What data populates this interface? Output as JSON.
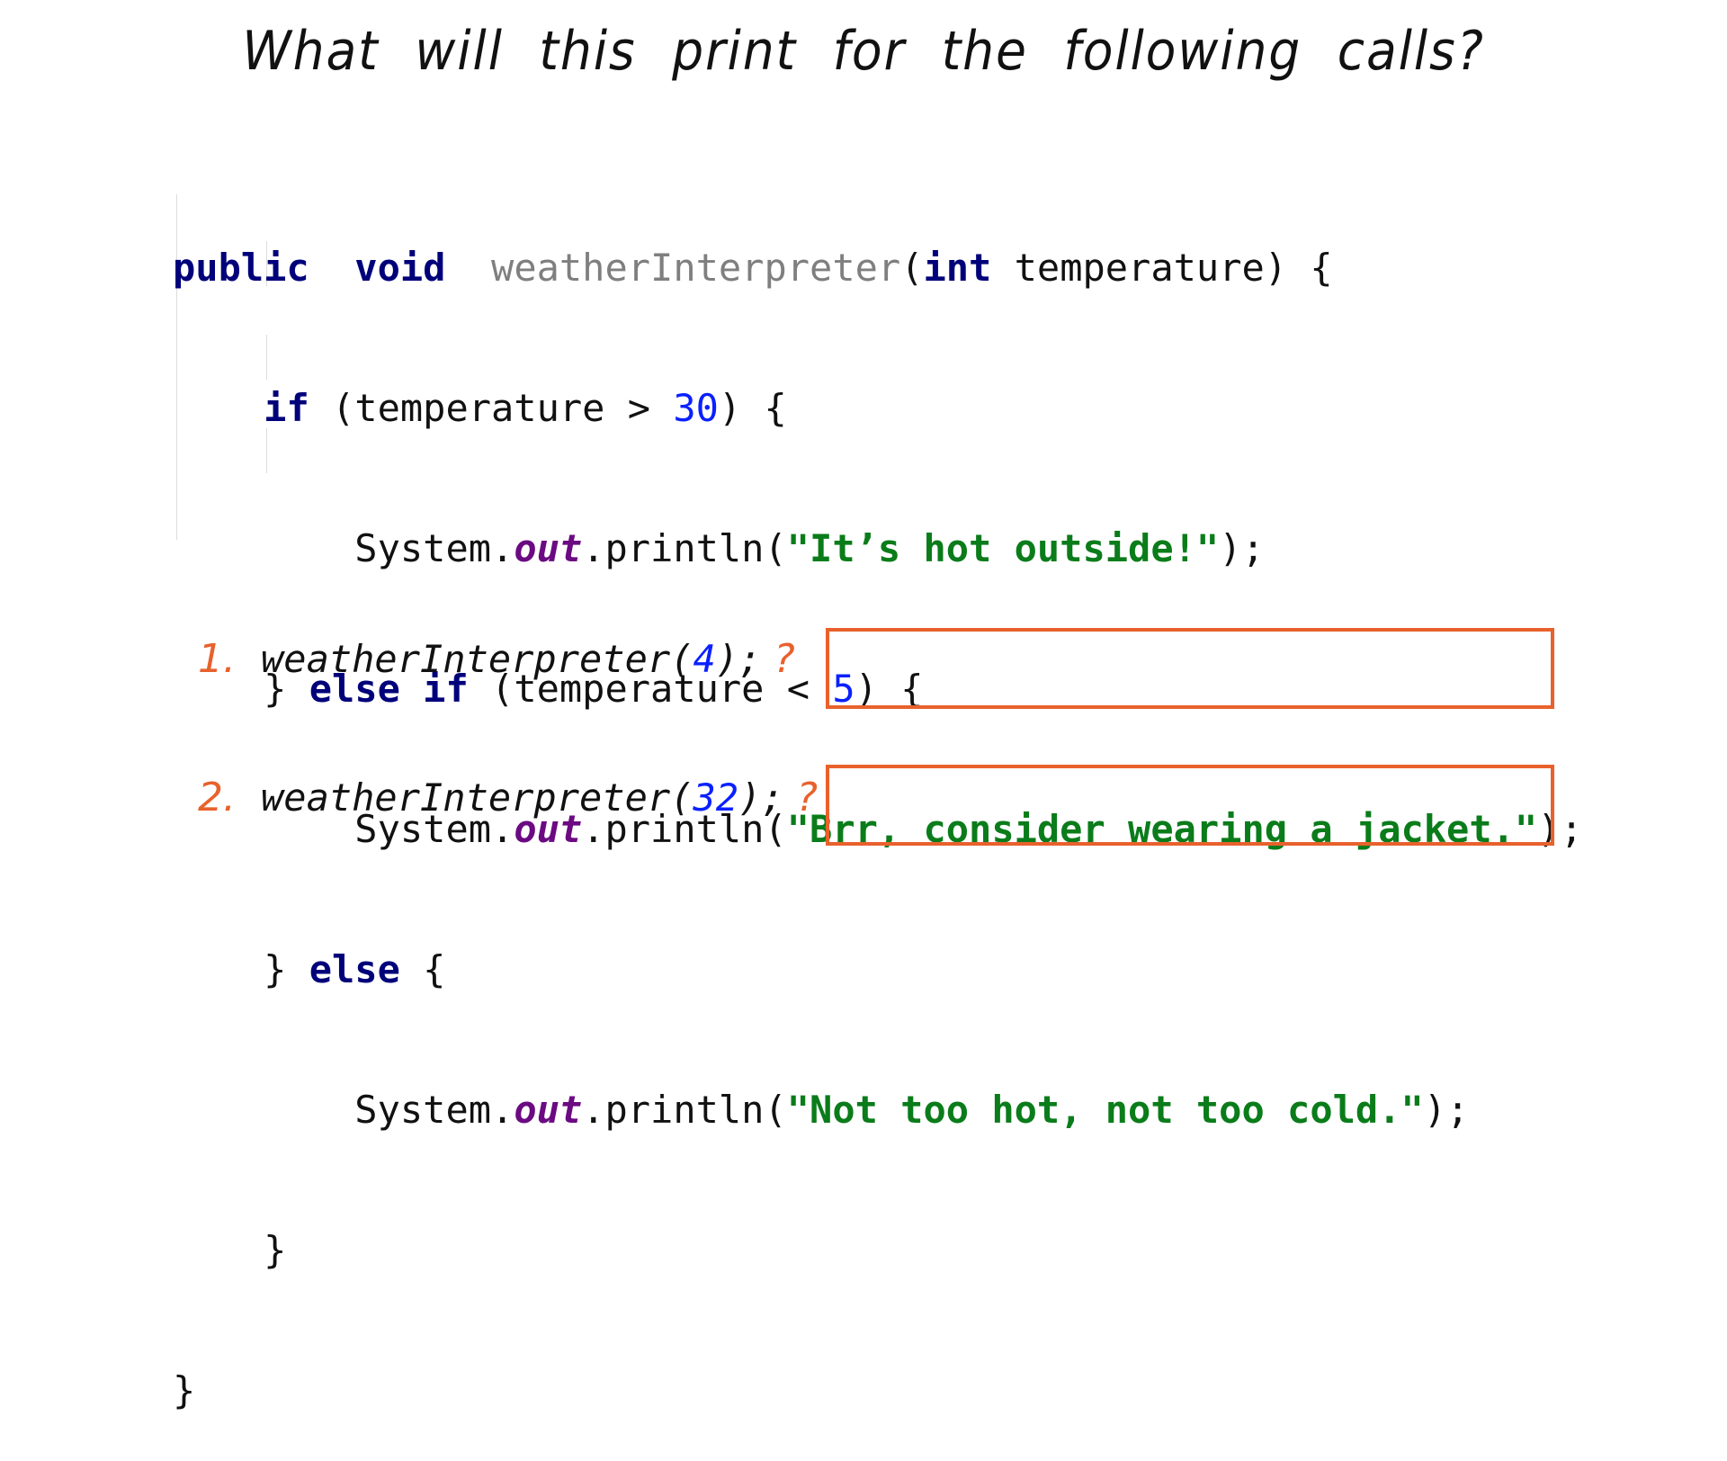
{
  "title": "What will this print for the following calls?",
  "code": {
    "l1": {
      "kw1": "public",
      "kw2": "void",
      "name": "weatherInterpreter",
      "open": "(",
      "kw3": "int",
      "rest": " temperature) {"
    },
    "l2": {
      "kw": "if",
      "a": " (temperature > ",
      "num": "30",
      "b": ") {"
    },
    "l3": {
      "a": "System.",
      "field": "out",
      "b": ".println(",
      "str": "\"It’s hot outside!\"",
      "c": ");"
    },
    "l4": {
      "a": "} ",
      "kw": "else if",
      "b": " (temperature < ",
      "num": "5",
      "c": ") {"
    },
    "l5": {
      "a": "System.",
      "field": "out",
      "b": ".println(",
      "str": "\"Brr, consider wearing a jacket.\"",
      "c": ");"
    },
    "l6": {
      "a": "} ",
      "kw": "else",
      "b": " {"
    },
    "l7": {
      "a": "System.",
      "field": "out",
      "b": ".println(",
      "str": "\"Not too hot, not too cold.\"",
      "c": ");"
    },
    "l8": {
      "a": "}"
    },
    "l9": {
      "a": "}"
    }
  },
  "questions": [
    {
      "number": "1.",
      "call_prefix": "weatherInterpreter(",
      "arg": "4",
      "call_suffix": ");",
      "mark": "?",
      "answer": ""
    },
    {
      "number": "2.",
      "call_prefix": "weatherInterpreter(",
      "arg": "32",
      "call_suffix": ");",
      "mark": "?",
      "answer": ""
    }
  ],
  "colors": {
    "keyword": "#00007a",
    "method_name": "#7f7f7f",
    "number": "#0a20ff",
    "string": "#0a7c1a",
    "field": "#6b0a82",
    "accent": "#e8612c"
  }
}
